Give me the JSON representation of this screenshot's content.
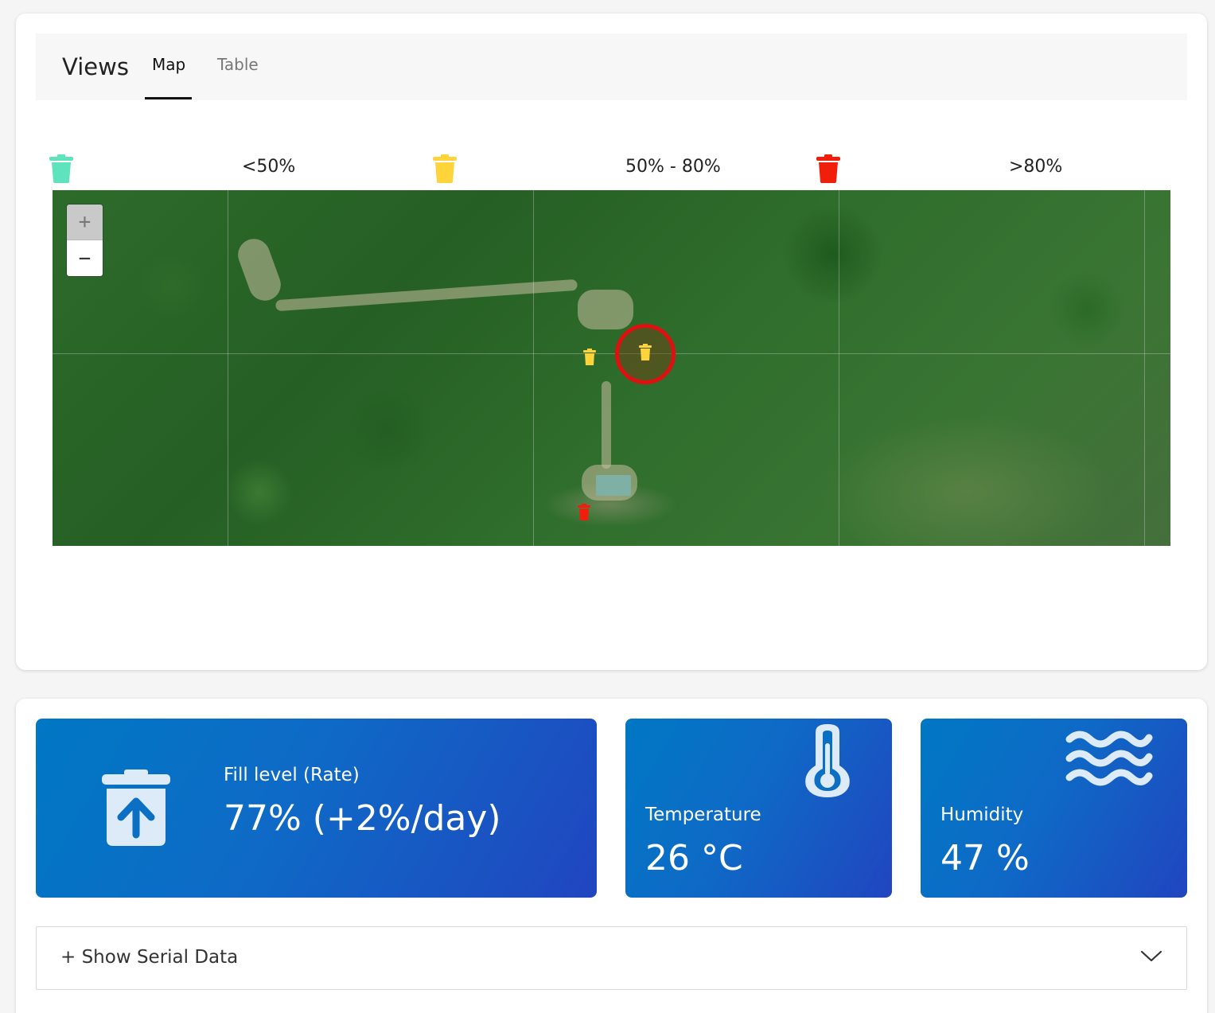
{
  "views": {
    "title": "Views",
    "tabs": [
      {
        "label": "Map",
        "active": true
      },
      {
        "label": "Table",
        "active": false
      }
    ]
  },
  "legend": [
    {
      "label": "<50%",
      "color": "#5fe3bd",
      "icon": "trash-can-green-icon"
    },
    {
      "label": "50% - 80%",
      "color": "#ffd43b",
      "icon": "trash-can-yellow-icon"
    },
    {
      "label": ">80%",
      "color": "#f01e0a",
      "icon": "trash-can-red-icon"
    }
  ],
  "map": {
    "zoom_in": "+",
    "zoom_out": "−",
    "markers": [
      {
        "status": "50% - 80%",
        "color": "#ffd43b"
      },
      {
        "status": "50% - 80%",
        "color": "#ffd43b",
        "selected": true
      },
      {
        "status": ">80%",
        "color": "#f01e0a"
      }
    ]
  },
  "stats": {
    "fill": {
      "label": "Fill level (Rate)",
      "value": "77% (+2%/day)",
      "icon": "trash-upload-icon"
    },
    "temperature": {
      "label": "Temperature",
      "value": "26 °C",
      "icon": "thermometer-icon"
    },
    "humidity": {
      "label": "Humidity",
      "value": "47 %",
      "icon": "waves-icon"
    }
  },
  "serial": {
    "label": "+ Show Serial Data",
    "icon": "chevron-down-icon"
  },
  "colors": {
    "card_gradient_start": "#0078c4",
    "card_gradient_end": "#2145c0",
    "selection_ring": "#e01010"
  }
}
